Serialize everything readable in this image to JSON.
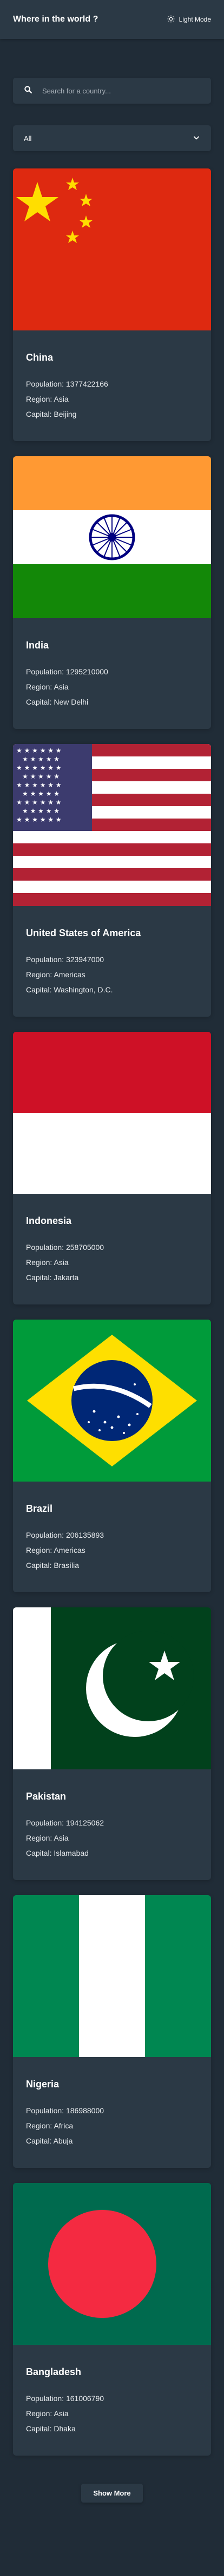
{
  "header": {
    "title": "Where in the world ?",
    "mode_toggle_label": "Light Mode",
    "mode_icon": "sun-icon"
  },
  "search": {
    "placeholder": "Search for a country...",
    "value": "",
    "icon": "search-icon"
  },
  "filter": {
    "selected": "All",
    "icon": "chevron-down-icon"
  },
  "stat_labels": {
    "population": "Population:",
    "region": "Region:",
    "capital": "Capital:"
  },
  "countries": [
    {
      "name": "China",
      "population": "1377422166",
      "region": "Asia",
      "capital": "Beijing",
      "flag_icon": "china-flag"
    },
    {
      "name": "India",
      "population": "1295210000",
      "region": "Asia",
      "capital": "New Delhi",
      "flag_icon": "india-flag"
    },
    {
      "name": "United States of America",
      "population": "323947000",
      "region": "Americas",
      "capital": "Washington, D.C.",
      "flag_icon": "usa-flag"
    },
    {
      "name": "Indonesia",
      "population": "258705000",
      "region": "Asia",
      "capital": "Jakarta",
      "flag_icon": "indonesia-flag"
    },
    {
      "name": "Brazil",
      "population": "206135893",
      "region": "Americas",
      "capital": "Brasília",
      "flag_icon": "brazil-flag"
    },
    {
      "name": "Pakistan",
      "population": "194125062",
      "region": "Asia",
      "capital": "Islamabad",
      "flag_icon": "pakistan-flag"
    },
    {
      "name": "Nigeria",
      "population": "186988000",
      "region": "Africa",
      "capital": "Abuja",
      "flag_icon": "nigeria-flag"
    },
    {
      "name": "Bangladesh",
      "population": "161006790",
      "region": "Asia",
      "capital": "Dhaka",
      "flag_icon": "bangladesh-flag"
    }
  ],
  "show_more_label": "Show More",
  "colors": {
    "background": "#202c37",
    "element": "#2b3945",
    "text": "#ffffff"
  }
}
